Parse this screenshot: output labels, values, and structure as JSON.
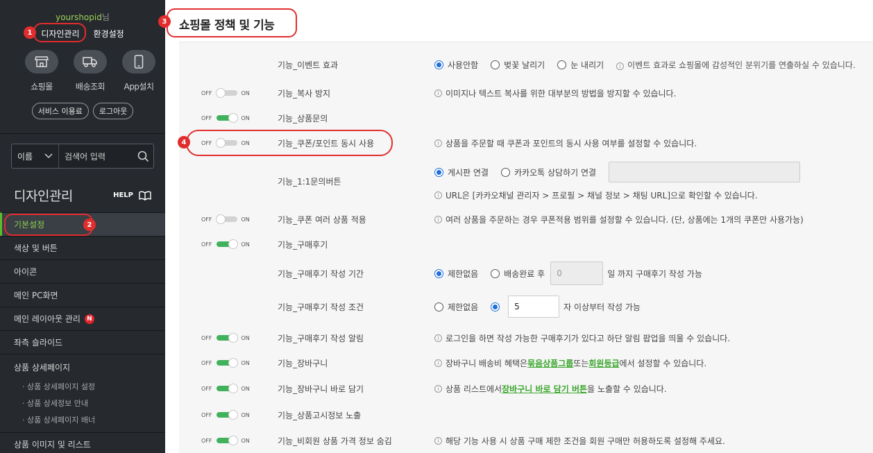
{
  "sidebar": {
    "user_id": "yourshopid",
    "user_suffix": "님",
    "top_links": [
      "디자인관리",
      "환경설정"
    ],
    "quick_items": [
      {
        "label": "쇼핑몰",
        "icon": "store-icon"
      },
      {
        "label": "배송조회",
        "icon": "truck-icon"
      },
      {
        "label": "App설치",
        "icon": "mobile-icon"
      }
    ],
    "pills": [
      "서비스 이용료",
      "로그아웃"
    ],
    "search": {
      "select": "이름",
      "placeholder": "검색어 입력"
    },
    "section_title": "디자인관리",
    "help_label": "HELP",
    "menu": [
      {
        "label": "기본설정",
        "active": true
      },
      {
        "label": "색상 및 버튼"
      },
      {
        "label": "아이콘"
      },
      {
        "label": "메인 PC화면"
      },
      {
        "label": "메인 레이아웃 관리",
        "badge": "N"
      },
      {
        "label": "좌측 슬라이드"
      }
    ],
    "sub_section": {
      "label": "상품 상세페이지",
      "items": [
        "· 상품 상세페이지 설정",
        "· 상품 상세정보 안내",
        "· 상품 상세페이지 배너"
      ]
    },
    "last_menu": "상품 이미지 및 리스트"
  },
  "page": {
    "title": "쇼핑몰 정책 및 기능"
  },
  "toggle_text": {
    "off": "OFF",
    "on": "ON"
  },
  "rows": {
    "event": {
      "label": "기능_이벤트 효과",
      "options": [
        "사용안함",
        "벚꽃 날리기",
        "눈 내리기"
      ],
      "info": "이벤트 효과로 쇼핑몰에 감성적인 분위기를 연출하실 수 있습니다."
    },
    "copy": {
      "label": "기능_복사 방지",
      "toggle": "off",
      "info": "이미지나 텍스트 복사를 위한 대부분의 방법을 방지할 수 있습니다."
    },
    "inquiry": {
      "label": "기능_상품문의",
      "toggle": "on"
    },
    "coupon_point": {
      "label": "기능_쿠폰/포인트 동시 사용",
      "toggle": "off",
      "info": "상품을 주문할 때 쿠폰과 포인트의 동시 사용 여부를 설정할 수 있습니다."
    },
    "one_to_one": {
      "label": "기능_1:1문의버튼",
      "options": [
        "게시판 연결",
        "카카오톡 상담하기 연결"
      ],
      "info": "URL은 [카카오채널 관리자 > 프로필 > 채널 정보 > 채팅 URL]으로 확인할 수 있습니다."
    },
    "coupon_multi": {
      "label": "기능_쿠폰 여러 상품 적용",
      "toggle": "off",
      "info": "여러 상품을 주문하는 경우 쿠폰적용 범위를 설정할 수 있습니다. (단, 상품에는 1개의 쿠폰만 사용가능)"
    },
    "review": {
      "label": "기능_구매후기",
      "toggle": "on"
    },
    "review_period": {
      "label": "기능_구매후기 작성 기간",
      "options": [
        "제한없음",
        "배송완료 후"
      ],
      "days_value": "0",
      "suffix": "일 까지 구매후기 작성 가능"
    },
    "review_cond": {
      "label": "기능_구매후기 작성 조건",
      "options": [
        "제한없음",
        ""
      ],
      "count_value": "5",
      "suffix": "자 이상부터 작성 가능"
    },
    "review_alert": {
      "label": "기능_구매후기 작성 알림",
      "toggle": "on",
      "info": "로그인을 하면 작성 가능한 구매후기가 있다고 하단 알림 팝업을 띄울 수 있습니다."
    },
    "cart": {
      "label": "기능_장바구니",
      "toggle": "on",
      "info_a": "장바구니 배송비 혜택은 ",
      "link1": "묶음상품그룹",
      "info_b": " 또는 ",
      "link2": "회원등급",
      "info_c": "에서 설정할 수 있습니다."
    },
    "cart_direct": {
      "label": "기능_장바구니 바로 담기",
      "toggle": "on",
      "info_a": "상품 리스트에서 ",
      "link": "장바구니 바로 담기 버튼",
      "info_b": " 을 노출할 수 있습니다."
    },
    "notice": {
      "label": "기능_상품고시정보 노출",
      "toggle": "on"
    },
    "guest_price": {
      "label": "기능_비회원 상품 가격 정보 숨김",
      "toggle": "on",
      "info": "해당 기능 사용 시 상품 구매 제한 조건을 회원 구매만 허용하도록 설정해 주세요."
    }
  },
  "annotations": [
    "1",
    "2",
    "3",
    "4"
  ],
  "colors": {
    "accent_green": "#41b25c",
    "annotation_red": "#e22d2d",
    "radio_blue": "#1e6fd9",
    "sidebar_bg": "#26292e"
  }
}
